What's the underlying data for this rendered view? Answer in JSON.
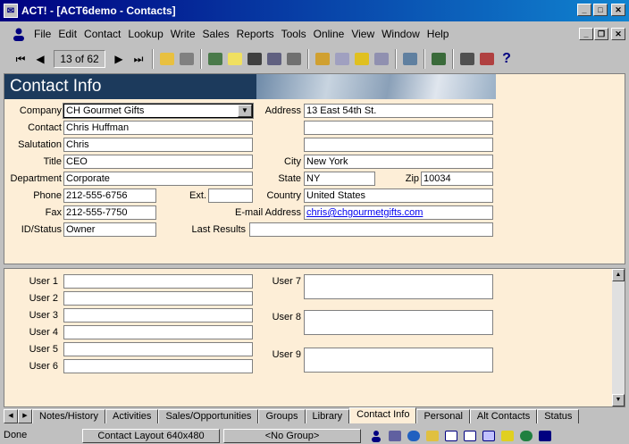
{
  "window": {
    "title": "ACT! - [ACT6demo - Contacts]"
  },
  "menu": {
    "items": [
      "File",
      "Edit",
      "Contact",
      "Lookup",
      "Write",
      "Sales",
      "Reports",
      "Tools",
      "Online",
      "View",
      "Window",
      "Help"
    ]
  },
  "toolbar": {
    "record_counter": "13 of 62"
  },
  "form": {
    "header": "Contact Info",
    "company_label": "Company",
    "company": "CH Gourmet Gifts",
    "contact_label": "Contact",
    "contact": "Chris Huffman",
    "salutation_label": "Salutation",
    "salutation": "Chris",
    "title_label": "Title",
    "title": "CEO",
    "department_label": "Department",
    "department": "Corporate",
    "phone_label": "Phone",
    "phone": "212-555-6756",
    "ext_label": "Ext.",
    "ext": "",
    "fax_label": "Fax",
    "fax": "212-555-7750",
    "idstatus_label": "ID/Status",
    "idstatus": "Owner",
    "address_label": "Address",
    "address1": "13 East 54th St.",
    "address2": "",
    "address3": "",
    "city_label": "City",
    "city": "New York",
    "state_label": "State",
    "state": "NY",
    "zip_label": "Zip",
    "zip": "10034",
    "country_label": "Country",
    "country": "United States",
    "email_label": "E-mail Address",
    "email": "chris@chgourmetgifts.com",
    "lastresults_label": "Last Results",
    "lastresults": ""
  },
  "user_fields": {
    "user1": "User 1",
    "user2": "User 2",
    "user3": "User 3",
    "user4": "User 4",
    "user5": "User 5",
    "user6": "User 6",
    "user7": "User 7",
    "user8": "User 8",
    "user9": "User 9"
  },
  "tabs": [
    "Notes/History",
    "Activities",
    "Sales/Opportunities",
    "Groups",
    "Library",
    "Contact Info",
    "Personal",
    "Alt Contacts",
    "Status"
  ],
  "status": {
    "left": "Done",
    "layout": "Contact Layout 640x480",
    "group": "<No Group>"
  }
}
